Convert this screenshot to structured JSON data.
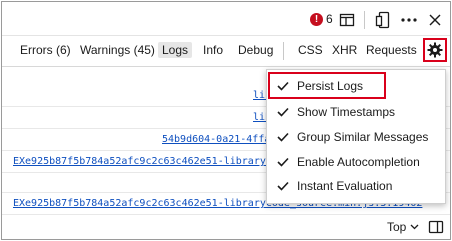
{
  "toolbar": {
    "error_count": "6",
    "error_icon": "error-circle-icon",
    "icons": [
      "dock-panel-icon",
      "device-emulation-icon",
      "more-options-icon",
      "close-icon"
    ]
  },
  "tabs": [
    {
      "label": "Errors (6)"
    },
    {
      "label": "Warnings (45)"
    },
    {
      "label": "Logs",
      "active": true
    },
    {
      "label": "Info"
    },
    {
      "label": "Debug"
    },
    {
      "label": "CSS"
    },
    {
      "label": "XHR"
    },
    {
      "label": "Requests"
    }
  ],
  "console": {
    "rows": [
      {
        "text": "lib"
      },
      {
        "text": "lib"
      },
      {
        "text": "54b9d604-0a21-4ffa"
      },
      {
        "text": "EXe925b87f5b784a52afc9c2c63c462e51-libraryCode"
      },
      {
        "text": ""
      },
      {
        "text": "EXe925b87f5b784a52afc9c2c63c462e51-libraryCode_source.min.js:3:19402"
      }
    ]
  },
  "settings_menu": {
    "items": [
      {
        "label": "Persist Logs",
        "checked": true
      },
      {
        "label": "Show Timestamps",
        "checked": true
      },
      {
        "label": "Group Similar Messages",
        "checked": true
      },
      {
        "label": "Enable Autocompletion",
        "checked": true
      },
      {
        "label": "Instant Evaluation",
        "checked": true
      }
    ]
  },
  "bottom": {
    "context_label": "Top",
    "context_icon": "chevron-down-icon",
    "sidebar_icon": "sidebar-toggle-icon"
  },
  "colors": {
    "highlight": "#d9001b",
    "error": "#c50f1f",
    "link": "#0e4fbf"
  }
}
